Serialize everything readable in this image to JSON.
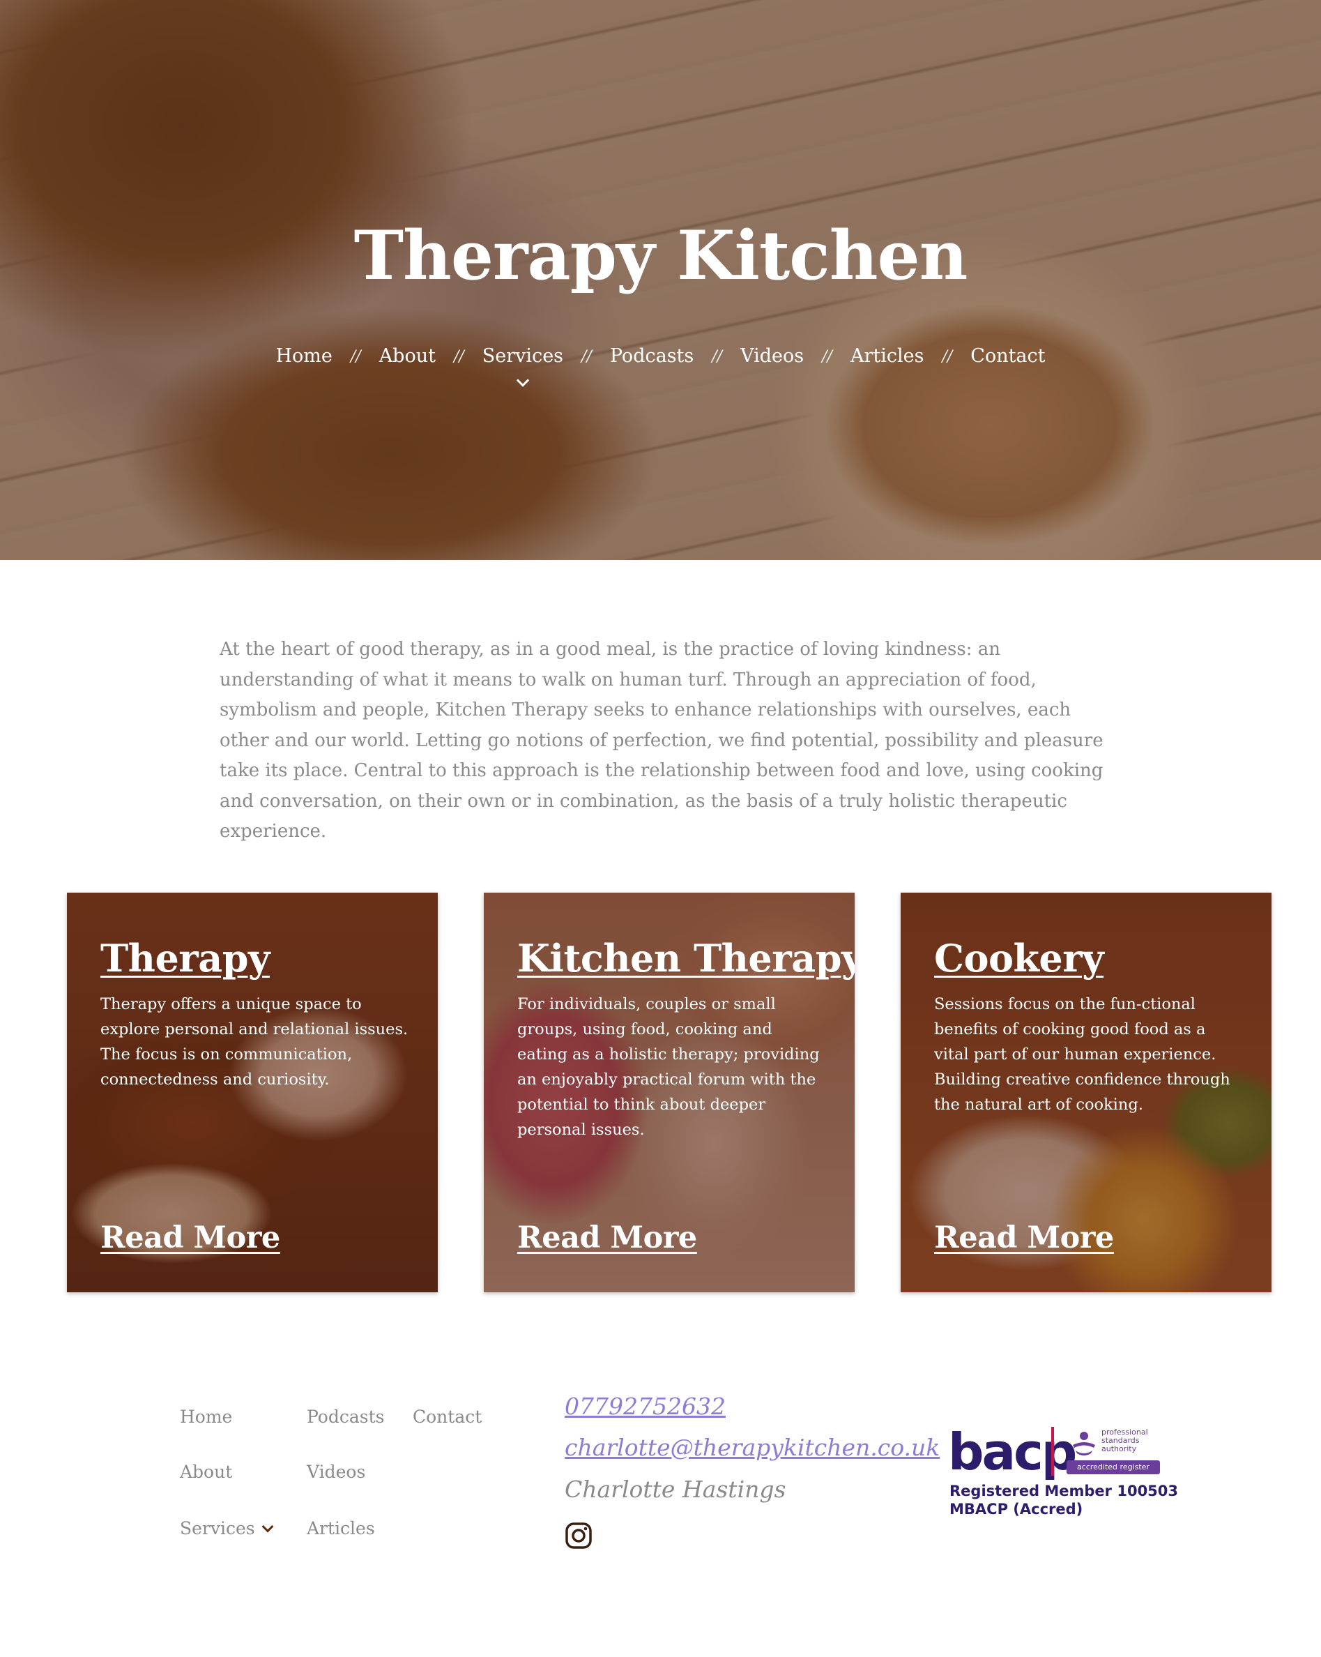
{
  "hero": {
    "title": "Therapy Kitchen",
    "nav": [
      {
        "label": "Home"
      },
      {
        "label": "About"
      },
      {
        "label": "Services"
      },
      {
        "label": "Podcasts"
      },
      {
        "label": "Videos"
      },
      {
        "label": "Articles"
      },
      {
        "label": "Contact"
      }
    ],
    "separator": "//"
  },
  "intro": {
    "text": "At the heart of good therapy, as in a good meal, is the practice of loving kindness: an understanding of what it means to walk on human turf. Through an appreciation of food, symbolism and people, Kitchen Therapy seeks to enhance relationships with ourselves, each other and our world. Letting go notions of perfection, we find potential, possibility and pleasure take its place. Central to this approach is the relationship between food and love, using cooking and conversation, on their own or in combination, as the basis of a truly holistic therapeutic experience."
  },
  "cards": [
    {
      "title": "Therapy",
      "text": "Therapy offers a unique space to explore personal and relational issues. The focus is on communication, connectedness and curiosity.",
      "link": "Read More"
    },
    {
      "title": "Kitchen Therapy",
      "text": "For individuals, couples or small groups, using food, cooking and eating as a holistic therapy; providing an enjoyably practical forum with the potential to think about deeper personal issues.",
      "link": "Read More"
    },
    {
      "title": "Cookery",
      "text": "Sessions focus on the fun-ctional benefits of cooking good food as a vital part of our human experience. Building creative confidence through the natural art of cooking.",
      "link": "Read More"
    }
  ],
  "footer": {
    "nav_col1": [
      "Home",
      "About",
      "Services"
    ],
    "nav_col2": [
      "Podcasts",
      "Videos",
      "Articles"
    ],
    "nav_col3": [
      "Contact"
    ],
    "phone": "07792752632",
    "email": "charlotte@therapykitchen.co.uk",
    "name": "Charlotte Hastings",
    "social_icon": "instagram-icon",
    "badge": {
      "brand": "bacp",
      "psa_text": "professional standards authority",
      "accredited": "accredited register",
      "line1_prefix": "Registered Member ",
      "member_number": "100503",
      "line2": "MBACP (Accred)"
    }
  },
  "colors": {
    "accent_link": "#8e7bd4",
    "hero_overlay": "#5e341a",
    "card_overlay": "#5c2612",
    "muted_text": "#8a8a8a",
    "chevron": "#5a2d12"
  }
}
